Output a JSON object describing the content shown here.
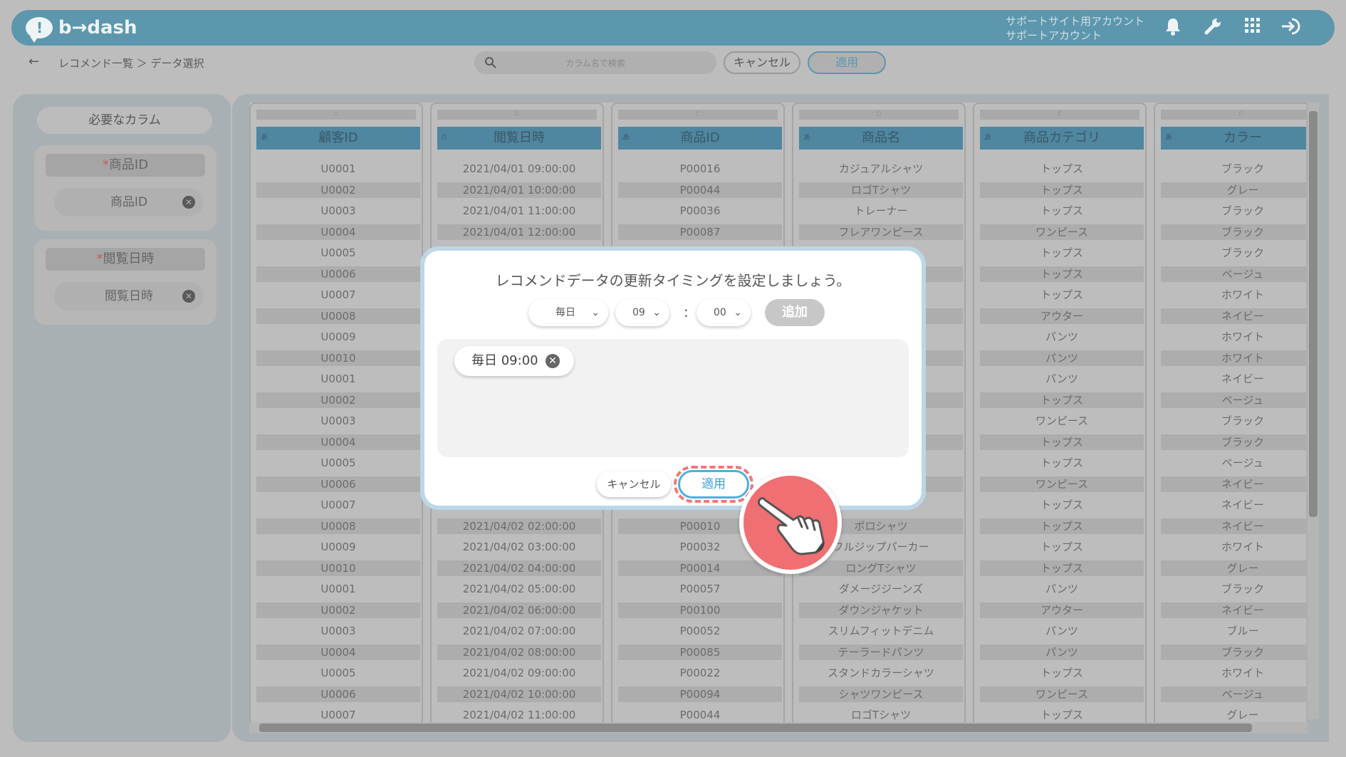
{
  "header": {
    "logo_glyph": "!",
    "logo_text": "b→dash",
    "account_line1": "サポートサイト用アカウント",
    "account_line2": "サポートアカウント",
    "icons": [
      "bell-icon",
      "wrench-icon",
      "grid-apps-icon",
      "logout-icon"
    ]
  },
  "toolbar": {
    "back_glyph": "←",
    "breadcrumb": "レコメンド一覧 ＞ データ選択",
    "search_placeholder": "カラム名で検索",
    "cancel_label": "キャンセル",
    "apply_label": "適用"
  },
  "left_panel": {
    "title": "必要なカラム",
    "required": [
      {
        "label": "商品ID",
        "chip": "商品ID"
      },
      {
        "label": "閲覧日時",
        "chip": "閲覧日時"
      }
    ]
  },
  "table": {
    "columns": [
      {
        "letter": "A",
        "type": "あ",
        "name": "顧客ID",
        "cells": [
          "U0001",
          "U0002",
          "U0003",
          "U0004",
          "U0005",
          "U0006",
          "U0007",
          "U0008",
          "U0009",
          "U0010",
          "U0001",
          "U0002",
          "U0003",
          "U0004",
          "U0005",
          "U0006",
          "U0007",
          "U0008",
          "U0009",
          "U0010",
          "U0001",
          "U0002",
          "U0003",
          "U0004",
          "U0005",
          "U0006",
          "U0007"
        ]
      },
      {
        "letter": "B",
        "type": "⏱",
        "name": "閲覧日時",
        "cells": [
          "2021/04/01 09:00:00",
          "2021/04/01 10:00:00",
          "2021/04/01 11:00:00",
          "2021/04/01 12:00:00",
          "",
          "",
          "",
          "",
          "",
          "",
          "",
          "",
          "",
          "",
          "",
          "",
          "",
          "2021/04/02 02:00:00",
          "2021/04/02 03:00:00",
          "2021/04/02 04:00:00",
          "2021/04/02 05:00:00",
          "2021/04/02 06:00:00",
          "2021/04/02 07:00:00",
          "2021/04/02 08:00:00",
          "2021/04/02 09:00:00",
          "2021/04/02 10:00:00",
          "2021/04/02 11:00:00"
        ]
      },
      {
        "letter": "C",
        "type": "あ",
        "name": "商品ID",
        "cells": [
          "P00016",
          "P00044",
          "P00036",
          "P00087",
          "",
          "",
          "",
          "",
          "",
          "",
          "",
          "",
          "",
          "",
          "",
          "",
          "",
          "P00010",
          "P00032",
          "P00014",
          "P00057",
          "P00100",
          "P00052",
          "P00085",
          "P00022",
          "P00094",
          "P00044"
        ]
      },
      {
        "letter": "D",
        "type": "あ",
        "name": "商品名",
        "cells": [
          "カジュアルシャツ",
          "ロゴTシャツ",
          "トレーナー",
          "フレアワンピース",
          "",
          "",
          "",
          "",
          "",
          "",
          "",
          "",
          "",
          "",
          "",
          "",
          "",
          "ポロシャツ",
          "フルジップパーカー",
          "ロングTシャツ",
          "ダメージジーンズ",
          "ダウンジャケット",
          "スリムフィットデニム",
          "テーラードパンツ",
          "スタンドカラーシャツ",
          "シャツワンピース",
          "ロゴTシャツ"
        ]
      },
      {
        "letter": "E",
        "type": "あ",
        "name": "商品カテゴリ",
        "cells": [
          "トップス",
          "トップス",
          "トップス",
          "ワンピース",
          "トップス",
          "トップス",
          "トップス",
          "アウター",
          "パンツ",
          "パンツ",
          "パンツ",
          "トップス",
          "ワンピース",
          "トップス",
          "トップス",
          "ワンピース",
          "トップス",
          "トップス",
          "トップス",
          "トップス",
          "パンツ",
          "アウター",
          "パンツ",
          "パンツ",
          "トップス",
          "ワンピース",
          "トップス"
        ]
      },
      {
        "letter": "F",
        "type": "あ",
        "name": "カラー",
        "cells": [
          "ブラック",
          "グレー",
          "ブラック",
          "ブラック",
          "ブラック",
          "ベージュ",
          "ホワイト",
          "ネイビー",
          "ホワイト",
          "ホワイト",
          "ネイビー",
          "ベージュ",
          "ブラック",
          "ブラック",
          "ベージュ",
          "ネイビー",
          "ネイビー",
          "ネイビー",
          "ホワイト",
          "グレー",
          "ブラック",
          "ネイビー",
          "ブルー",
          "ブラック",
          "ホワイト",
          "ベージュ",
          "グレー"
        ]
      }
    ]
  },
  "modal": {
    "title": "レコメンドデータの更新タイミングを設定しましょう。",
    "frequency": "毎日",
    "hour": "09",
    "colon": ":",
    "minute": "00",
    "add_label": "追加",
    "timings": [
      {
        "label": "毎日 09:00"
      }
    ],
    "cancel_label": "キャンセル",
    "apply_label": "適用"
  },
  "colors": {
    "brand": "#5c97ad",
    "apply_border": "#4ab1df",
    "highlight": "#ef7878",
    "pointer": "#ef6f72"
  }
}
